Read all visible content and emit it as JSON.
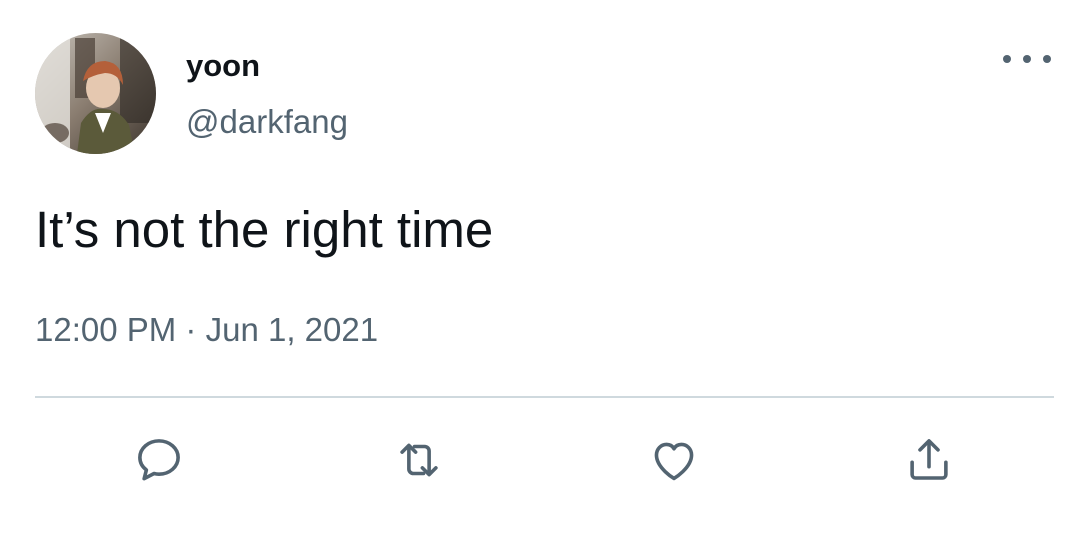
{
  "tweet": {
    "author": {
      "display_name": "yoon",
      "handle": "@darkfang",
      "avatar_icon": "profile-photo"
    },
    "text": "It’s not the right time",
    "time": "12:00 PM",
    "separator": "·",
    "date": "Jun 1, 2021"
  },
  "actions": [
    {
      "name": "reply",
      "icon": "speech-bubble-icon"
    },
    {
      "name": "retweet",
      "icon": "retweet-arrows-icon"
    },
    {
      "name": "like",
      "icon": "heart-icon"
    },
    {
      "name": "share",
      "icon": "share-upload-icon"
    }
  ],
  "colors": {
    "text_primary": "#0f1419",
    "text_secondary": "#536471",
    "divider": "#cfd9de",
    "background": "#ffffff"
  }
}
